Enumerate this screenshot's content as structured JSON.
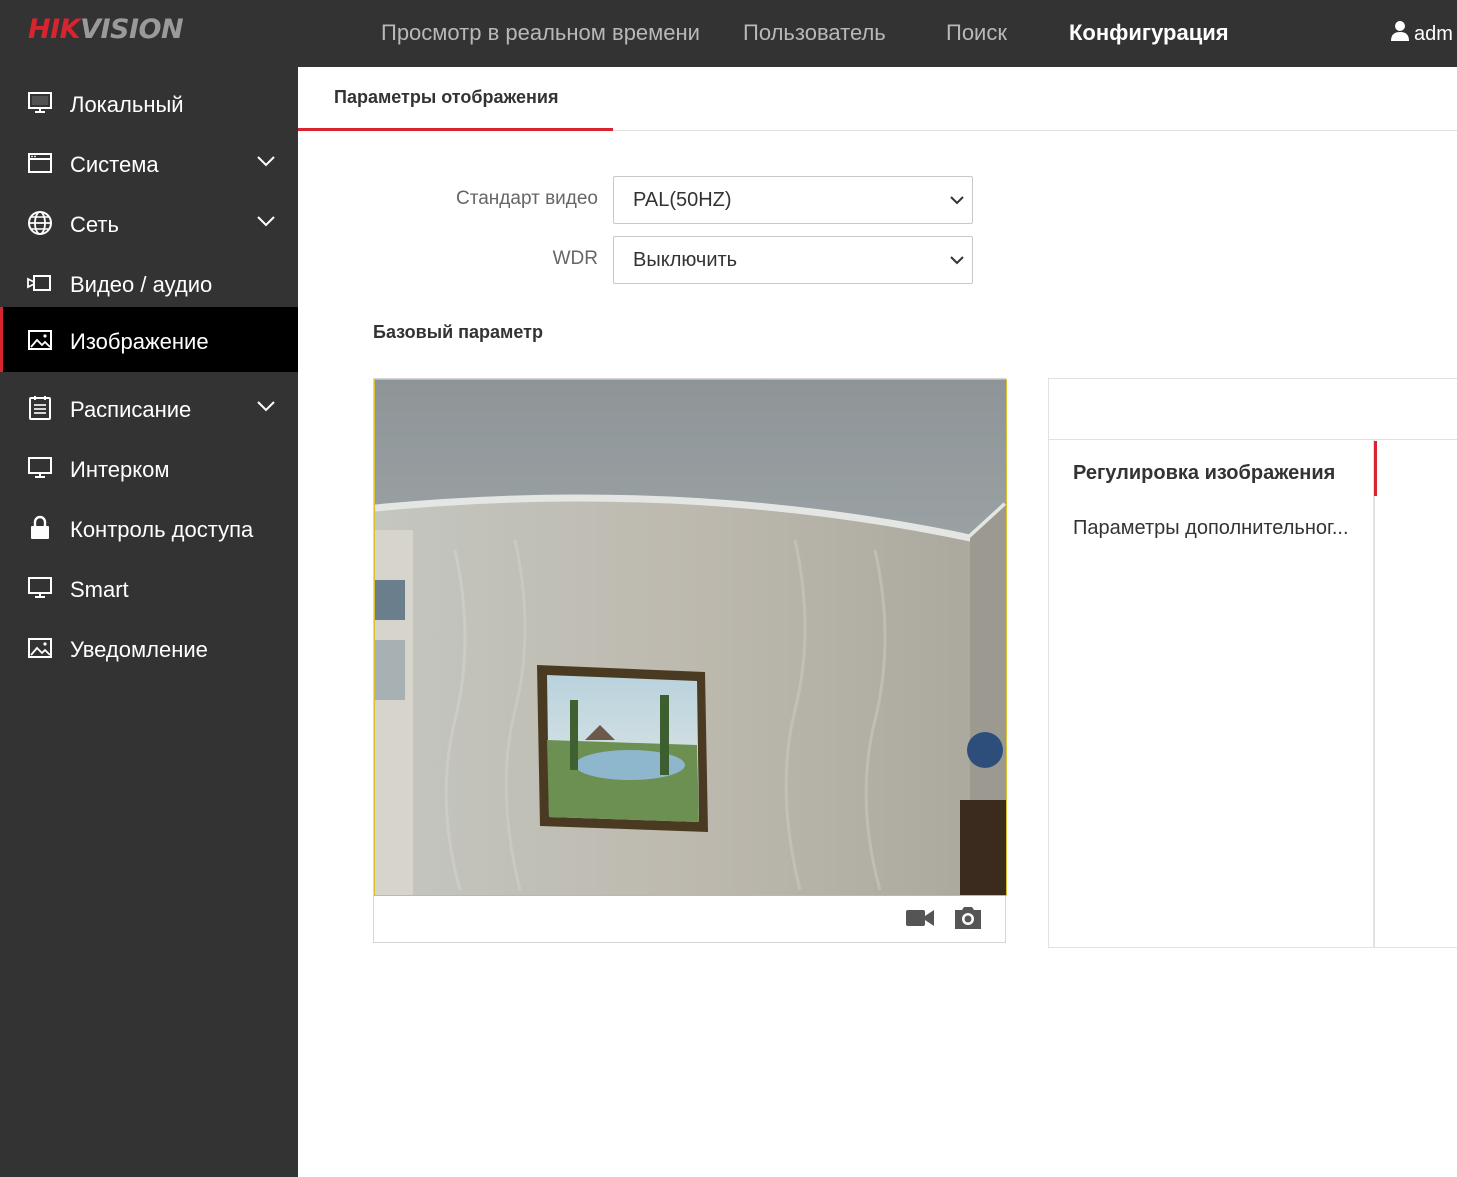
{
  "brand": {
    "logo_part1": "HIK",
    "logo_part2": "VISION"
  },
  "topnav": {
    "live": "Просмотр в реальном времени",
    "user": "Пользователь",
    "search": "Поиск",
    "config": "Конфигурация",
    "account": "adm",
    "active": "config"
  },
  "sidebar": {
    "items": [
      {
        "label": "Локальный",
        "icon": "monitor-icon",
        "expandable": false
      },
      {
        "label": "Система",
        "icon": "window-icon",
        "expandable": true
      },
      {
        "label": "Сеть",
        "icon": "globe-icon",
        "expandable": true
      },
      {
        "label": "Видео / аудио",
        "icon": "video-icon",
        "expandable": false
      },
      {
        "label": "Изображение",
        "icon": "image-icon",
        "expandable": false,
        "active": true
      },
      {
        "label": "Расписание",
        "icon": "schedule-icon",
        "expandable": true
      },
      {
        "label": "Интерком",
        "icon": "monitor-icon",
        "expandable": false
      },
      {
        "label": "Контроль доступа",
        "icon": "lock-icon",
        "expandable": false
      },
      {
        "label": "Smart",
        "icon": "monitor-icon",
        "expandable": false
      },
      {
        "label": "Уведомление",
        "icon": "image-icon",
        "expandable": false
      }
    ]
  },
  "tabs": {
    "display_params": "Параметры отображения"
  },
  "form": {
    "video_standard_label": "Стандарт видео",
    "video_standard_value": "PAL(50HZ)",
    "wdr_label": "WDR",
    "wdr_value": "Выключить"
  },
  "section": {
    "basic_param": "Базовый параметр"
  },
  "preview": {
    "record_icon": "video-camera-icon",
    "snapshot_icon": "camera-icon"
  },
  "panel": {
    "image_adjust": "Регулировка изображения",
    "advanced_params": "Параметры дополнительног..."
  },
  "colors": {
    "accent": "#d8242f",
    "bar": "#333333",
    "active_item": "#000000"
  }
}
